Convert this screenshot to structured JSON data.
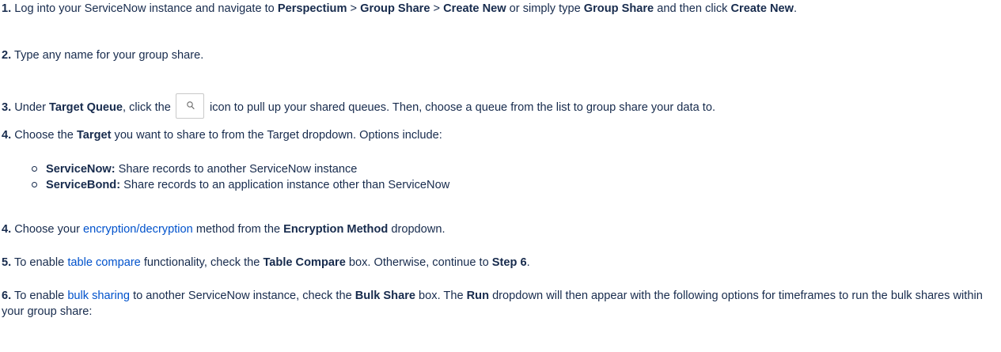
{
  "step1": {
    "num": "1.",
    "t1": " Log into your ServiceNow instance and navigate to ",
    "b1": "Perspectium",
    "t2": " > ",
    "b2": "Group Share",
    "t3": " > ",
    "b3": "Create New",
    "t4": " or simply type ",
    "b4": "Group Share",
    "t5": " and then click ",
    "b5": "Create New",
    "t6": "."
  },
  "step2": {
    "num": "2.",
    "t1": " Type any name for your group share."
  },
  "step3": {
    "num": "3.",
    "t1": " Under ",
    "b1": "Target Queue",
    "t2": ", click the ",
    "icon": "search-icon",
    "t3": " icon to pull up your shared queues. Then, choose a queue from the list to group share your data to."
  },
  "step4a": {
    "num": "4.",
    "t1": " Choose the ",
    "b1": "Target",
    "t2": " you want to share to from the Target dropdown. Options include:"
  },
  "options": [
    {
      "bold": "ServiceNow:",
      "text": " Share records to another ServiceNow instance"
    },
    {
      "bold": "ServiceBond:",
      "text": " Share records to an application instance other than ServiceNow"
    }
  ],
  "step4b": {
    "num": "4.",
    "t1": " Choose your ",
    "link": "encryption/decryption",
    "t2": " method from the ",
    "b1": "Encryption Method",
    "t3": " dropdown."
  },
  "step5": {
    "num": "5.",
    "t1": " To enable ",
    "link": "table compare",
    "t2": " functionality, check the ",
    "b1": "Table Compare",
    "t3": " box. Otherwise, continue to ",
    "b2": "Step 6",
    "t4": "."
  },
  "step6": {
    "num": "6.",
    "t1": " To enable ",
    "link": "bulk sharing",
    "t2": " to another ServiceNow instance, check the ",
    "b1": "Bulk Share",
    "t3": " box. The ",
    "b2": "Run",
    "t4": " dropdown will then appear with the following options for timeframes to run the bulk shares within your group share:"
  },
  "colors": {
    "text": "#172b4d",
    "link": "#0052cc",
    "icon_border": "#c9c9c9"
  }
}
